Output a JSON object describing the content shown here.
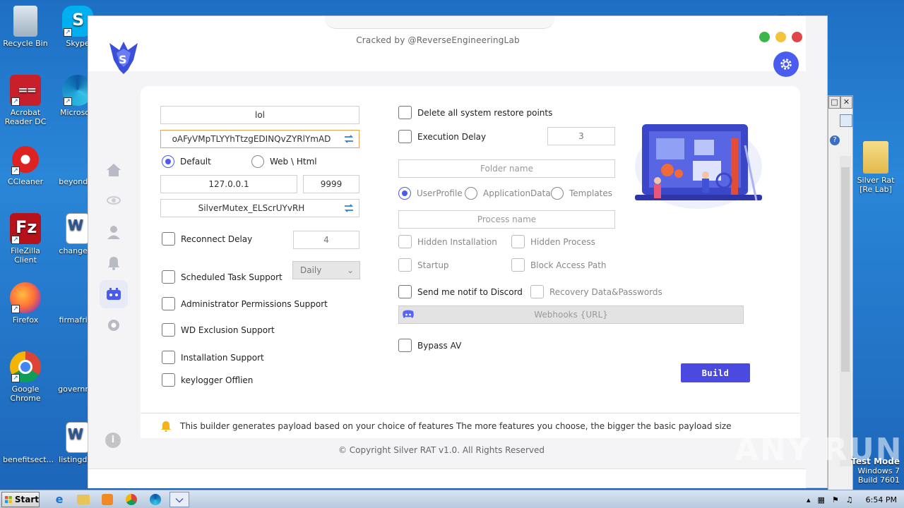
{
  "desktop": {
    "icons": [
      {
        "label": "Recycle Bin",
        "icon": "recycle-bin-icon"
      },
      {
        "label": "Skype",
        "icon": "skype-icon"
      },
      {
        "label": "Acrobat Reader DC",
        "icon": "acrobat-icon"
      },
      {
        "label": "Microsoft",
        "icon": "edge-icon"
      },
      {
        "label": "CCleaner",
        "icon": "ccleaner-icon"
      },
      {
        "label": "beyondse",
        "icon": "word-doc-icon"
      },
      {
        "label": "FileZilla Client",
        "icon": "filezilla-icon"
      },
      {
        "label": "changesp",
        "icon": "word-doc-icon"
      },
      {
        "label": "Firefox",
        "icon": "firefox-icon"
      },
      {
        "label": "firmafrica",
        "icon": "blank-doc-icon"
      },
      {
        "label": "Google Chrome",
        "icon": "chrome-icon"
      },
      {
        "label": "governme",
        "icon": "blank-doc-icon"
      },
      {
        "label": "benefitsect...",
        "icon": "blank-doc-icon"
      },
      {
        "label": "listingdvd",
        "icon": "word-doc-icon"
      },
      {
        "label": "Silver Rat [Re Lab]",
        "icon": "folder-icon"
      }
    ]
  },
  "app": {
    "subtitle": "Cracked by @ReverseEngineeringLab",
    "window_dots": [
      "#3cb54a",
      "#f5c33b",
      "#e0454a"
    ],
    "accent": "#4a5cf0",
    "left": {
      "host_name": "lol",
      "key": "oAFyVMpTLYYhTtzgEDINQvZYRlYmAD",
      "radio_default": "Default",
      "radio_web": "Web \\ Html",
      "ip": "127.0.0.1",
      "port": "9999",
      "mutex": "SilverMutex_ELScrUYvRH",
      "reconnect_delay_label": "Reconnect Delay",
      "reconnect_delay_value": "4",
      "scheduled_task_label": "Scheduled Task Support",
      "schedule_option": "Daily",
      "admin_label": "Administrator Permissions Support",
      "wd_label": "WD Exclusion Support",
      "install_label": "Installation Support",
      "keylogger_label": "keylogger Offlien"
    },
    "right": {
      "delete_restore_label": "Delete all system restore points",
      "exec_delay_label": "Execution Delay",
      "exec_delay_value": "3",
      "folder_placeholder": "Folder name",
      "radio_userprofile": "UserProfile",
      "radio_appdata": "ApplicationData",
      "radio_templates": "Templates",
      "process_placeholder": "Process name",
      "hidden_install_label": "Hidden Installation",
      "hidden_process_label": "Hidden Process",
      "startup_label": "Startup",
      "block_access_label": "Block Access Path",
      "discord_label": "Send me notif to Discord",
      "recovery_label": "Recovery Data&Passwords",
      "webhook_placeholder": "Webhooks {URL}",
      "bypass_label": "Bypass AV",
      "build_label": "Build"
    },
    "notice": "This builder generates payload based on your choice of features The more features you choose, the bigger the basic payload size",
    "copyright": "© Copyright Silver RAT v1.0. All Rights Reserved"
  },
  "taskbar": {
    "start_label": "Start",
    "time": "6:54 PM"
  },
  "watermark": {
    "line1": "Test Mode",
    "line2": "Windows 7",
    "line3": "Build 7601",
    "brand": "ANY RUN"
  }
}
